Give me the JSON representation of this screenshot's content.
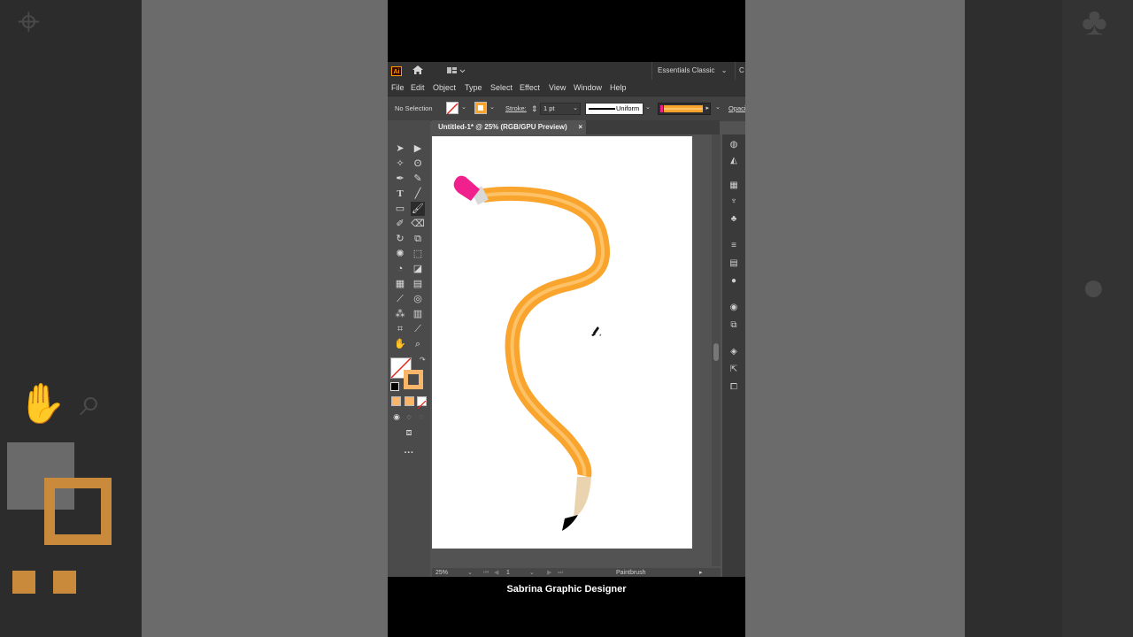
{
  "app": {
    "logo_text": "Ai",
    "workspace": "Essentials Classic",
    "workspace_extra": "C"
  },
  "menu": [
    "File",
    "Edit",
    "Object",
    "Type",
    "Select",
    "Effect",
    "View",
    "Window",
    "Help"
  ],
  "control_bar": {
    "selection": "No Selection",
    "stroke_label": "Stroke:",
    "stroke_weight": "1 pt",
    "profile": "Uniform",
    "opacity_label": "Opaci"
  },
  "document": {
    "tab_title": "Untitled-1* @ 25% (RGB/GPU Preview)",
    "close_symbol": "×"
  },
  "status": {
    "zoom": "25%",
    "artboard": "1",
    "tool": "Paintbrush"
  },
  "colors": {
    "pencil_body": "#f9a42c",
    "pencil_highlight": "#fdc267",
    "eraser": "#f0208c",
    "ferrule": "#d9d9d9",
    "wood": "#ead4b0",
    "lead": "#000000",
    "fill_swatch": "#f9b66a"
  },
  "caption": "Sabrina Graphic Designer"
}
